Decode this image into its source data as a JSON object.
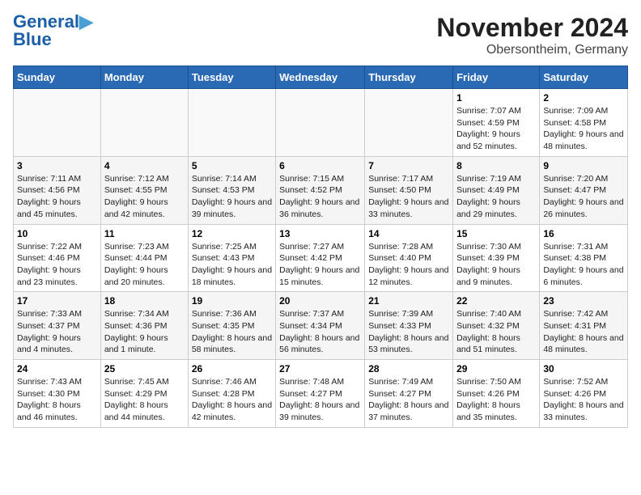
{
  "header": {
    "logo_line1": "General",
    "logo_line2": "Blue",
    "month": "November 2024",
    "location": "Obersontheim, Germany"
  },
  "days_of_week": [
    "Sunday",
    "Monday",
    "Tuesday",
    "Wednesday",
    "Thursday",
    "Friday",
    "Saturday"
  ],
  "weeks": [
    [
      {
        "day": "",
        "info": ""
      },
      {
        "day": "",
        "info": ""
      },
      {
        "day": "",
        "info": ""
      },
      {
        "day": "",
        "info": ""
      },
      {
        "day": "",
        "info": ""
      },
      {
        "day": "1",
        "info": "Sunrise: 7:07 AM\nSunset: 4:59 PM\nDaylight: 9 hours and 52 minutes."
      },
      {
        "day": "2",
        "info": "Sunrise: 7:09 AM\nSunset: 4:58 PM\nDaylight: 9 hours and 48 minutes."
      }
    ],
    [
      {
        "day": "3",
        "info": "Sunrise: 7:11 AM\nSunset: 4:56 PM\nDaylight: 9 hours and 45 minutes."
      },
      {
        "day": "4",
        "info": "Sunrise: 7:12 AM\nSunset: 4:55 PM\nDaylight: 9 hours and 42 minutes."
      },
      {
        "day": "5",
        "info": "Sunrise: 7:14 AM\nSunset: 4:53 PM\nDaylight: 9 hours and 39 minutes."
      },
      {
        "day": "6",
        "info": "Sunrise: 7:15 AM\nSunset: 4:52 PM\nDaylight: 9 hours and 36 minutes."
      },
      {
        "day": "7",
        "info": "Sunrise: 7:17 AM\nSunset: 4:50 PM\nDaylight: 9 hours and 33 minutes."
      },
      {
        "day": "8",
        "info": "Sunrise: 7:19 AM\nSunset: 4:49 PM\nDaylight: 9 hours and 29 minutes."
      },
      {
        "day": "9",
        "info": "Sunrise: 7:20 AM\nSunset: 4:47 PM\nDaylight: 9 hours and 26 minutes."
      }
    ],
    [
      {
        "day": "10",
        "info": "Sunrise: 7:22 AM\nSunset: 4:46 PM\nDaylight: 9 hours and 23 minutes."
      },
      {
        "day": "11",
        "info": "Sunrise: 7:23 AM\nSunset: 4:44 PM\nDaylight: 9 hours and 20 minutes."
      },
      {
        "day": "12",
        "info": "Sunrise: 7:25 AM\nSunset: 4:43 PM\nDaylight: 9 hours and 18 minutes."
      },
      {
        "day": "13",
        "info": "Sunrise: 7:27 AM\nSunset: 4:42 PM\nDaylight: 9 hours and 15 minutes."
      },
      {
        "day": "14",
        "info": "Sunrise: 7:28 AM\nSunset: 4:40 PM\nDaylight: 9 hours and 12 minutes."
      },
      {
        "day": "15",
        "info": "Sunrise: 7:30 AM\nSunset: 4:39 PM\nDaylight: 9 hours and 9 minutes."
      },
      {
        "day": "16",
        "info": "Sunrise: 7:31 AM\nSunset: 4:38 PM\nDaylight: 9 hours and 6 minutes."
      }
    ],
    [
      {
        "day": "17",
        "info": "Sunrise: 7:33 AM\nSunset: 4:37 PM\nDaylight: 9 hours and 4 minutes."
      },
      {
        "day": "18",
        "info": "Sunrise: 7:34 AM\nSunset: 4:36 PM\nDaylight: 9 hours and 1 minute."
      },
      {
        "day": "19",
        "info": "Sunrise: 7:36 AM\nSunset: 4:35 PM\nDaylight: 8 hours and 58 minutes."
      },
      {
        "day": "20",
        "info": "Sunrise: 7:37 AM\nSunset: 4:34 PM\nDaylight: 8 hours and 56 minutes."
      },
      {
        "day": "21",
        "info": "Sunrise: 7:39 AM\nSunset: 4:33 PM\nDaylight: 8 hours and 53 minutes."
      },
      {
        "day": "22",
        "info": "Sunrise: 7:40 AM\nSunset: 4:32 PM\nDaylight: 8 hours and 51 minutes."
      },
      {
        "day": "23",
        "info": "Sunrise: 7:42 AM\nSunset: 4:31 PM\nDaylight: 8 hours and 48 minutes."
      }
    ],
    [
      {
        "day": "24",
        "info": "Sunrise: 7:43 AM\nSunset: 4:30 PM\nDaylight: 8 hours and 46 minutes."
      },
      {
        "day": "25",
        "info": "Sunrise: 7:45 AM\nSunset: 4:29 PM\nDaylight: 8 hours and 44 minutes."
      },
      {
        "day": "26",
        "info": "Sunrise: 7:46 AM\nSunset: 4:28 PM\nDaylight: 8 hours and 42 minutes."
      },
      {
        "day": "27",
        "info": "Sunrise: 7:48 AM\nSunset: 4:27 PM\nDaylight: 8 hours and 39 minutes."
      },
      {
        "day": "28",
        "info": "Sunrise: 7:49 AM\nSunset: 4:27 PM\nDaylight: 8 hours and 37 minutes."
      },
      {
        "day": "29",
        "info": "Sunrise: 7:50 AM\nSunset: 4:26 PM\nDaylight: 8 hours and 35 minutes."
      },
      {
        "day": "30",
        "info": "Sunrise: 7:52 AM\nSunset: 4:26 PM\nDaylight: 8 hours and 33 minutes."
      }
    ]
  ]
}
